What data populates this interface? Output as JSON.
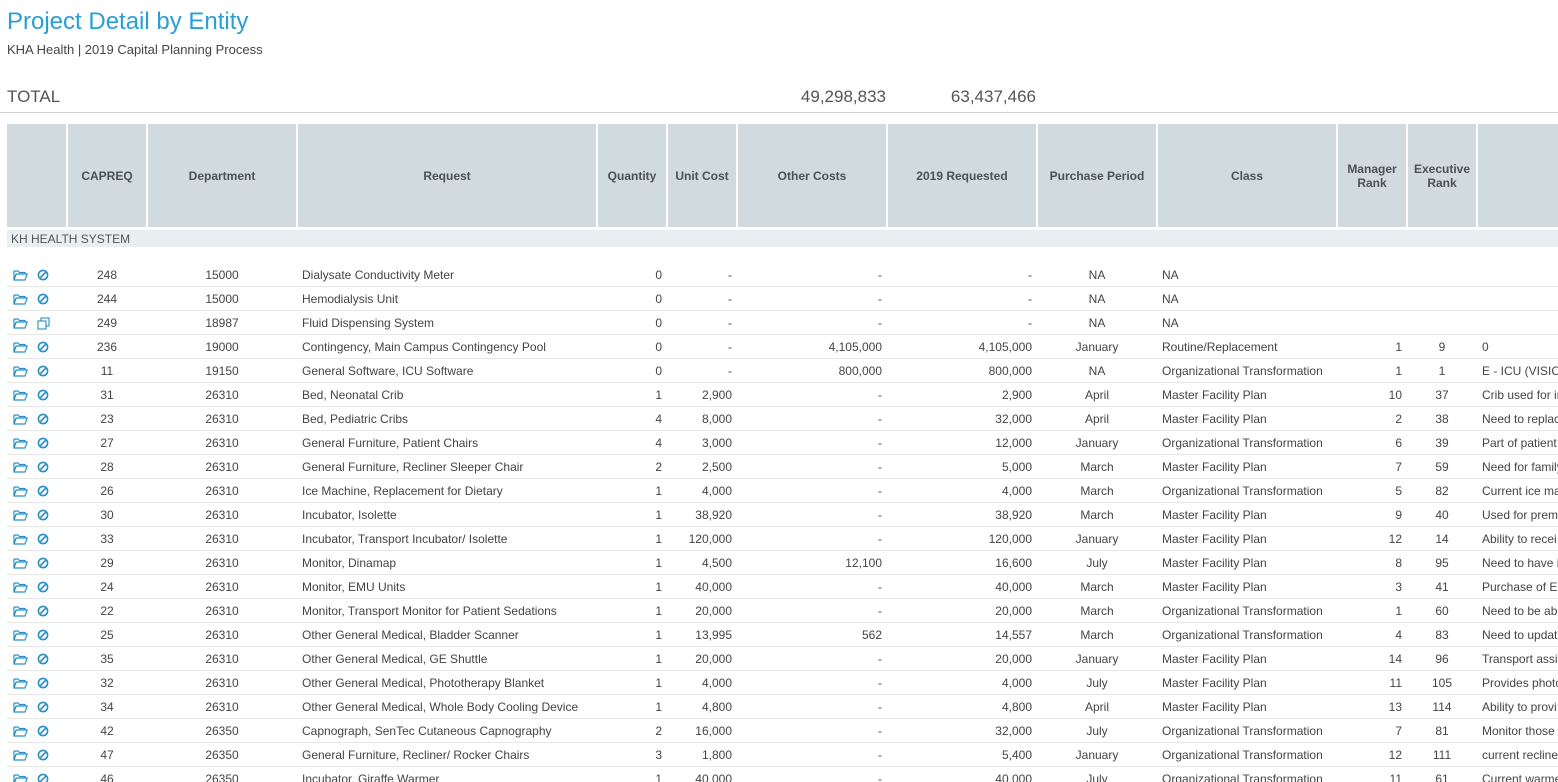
{
  "page": {
    "title": "Project Detail by Entity",
    "subtitle": "KHA Health | 2019 Capital Planning Process"
  },
  "totals": {
    "label": "TOTAL",
    "other_costs": "49,298,833",
    "requested": "63,437,466"
  },
  "table": {
    "columns": [
      "",
      "CAPREQ",
      "Department",
      "Request",
      "Quantity",
      "Unit Cost",
      "Other Costs",
      "2019 Requested",
      "Purchase Period",
      "Class",
      "Manager Rank",
      "Executive Rank",
      ""
    ],
    "group_label": "KH HEALTH SYSTEM",
    "rows": [
      {
        "icon": "cancel",
        "capreq": "248",
        "dept": "15000",
        "request": "Dialysate Conductivity Meter",
        "qty": "0",
        "unit": "-",
        "other": "-",
        "requested": "-",
        "period": "NA",
        "class": "NA",
        "mgr": "",
        "exec": "",
        "notes": ""
      },
      {
        "icon": "cancel",
        "capreq": "244",
        "dept": "15000",
        "request": "Hemodialysis Unit",
        "qty": "0",
        "unit": "-",
        "other": "-",
        "requested": "-",
        "period": "NA",
        "class": "NA",
        "mgr": "",
        "exec": "",
        "notes": ""
      },
      {
        "icon": "copy",
        "capreq": "249",
        "dept": "18987",
        "request": "Fluid Dispensing System",
        "qty": "0",
        "unit": "-",
        "other": "-",
        "requested": "-",
        "period": "NA",
        "class": "NA",
        "mgr": "",
        "exec": "",
        "notes": ""
      },
      {
        "icon": "cancel",
        "capreq": "236",
        "dept": "19000",
        "request": "Contingency, Main Campus Contingency Pool",
        "qty": "0",
        "unit": "-",
        "other": "4,105,000",
        "requested": "4,105,000",
        "period": "January",
        "class": "Routine/Replacement",
        "mgr": "1",
        "exec": "9",
        "notes": "0"
      },
      {
        "icon": "cancel",
        "capreq": "11",
        "dept": "19150",
        "request": "General Software, ICU Software",
        "qty": "0",
        "unit": "-",
        "other": "800,000",
        "requested": "800,000",
        "period": "NA",
        "class": "Organizational Transformation",
        "mgr": "1",
        "exec": "1",
        "notes": "E - ICU (VISICU"
      },
      {
        "icon": "cancel",
        "capreq": "31",
        "dept": "26310",
        "request": "Bed, Neonatal Crib",
        "qty": "1",
        "unit": "2,900",
        "other": "-",
        "requested": "2,900",
        "period": "April",
        "class": "Master Facility Plan",
        "mgr": "10",
        "exec": "37",
        "notes": "Crib used for in"
      },
      {
        "icon": "cancel",
        "capreq": "23",
        "dept": "26310",
        "request": "Bed, Pediatric Cribs",
        "qty": "4",
        "unit": "8,000",
        "other": "-",
        "requested": "32,000",
        "period": "April",
        "class": "Master Facility Plan",
        "mgr": "2",
        "exec": "38",
        "notes": "Need to replac"
      },
      {
        "icon": "cancel",
        "capreq": "27",
        "dept": "26310",
        "request": "General Furniture, Patient Chairs",
        "qty": "4",
        "unit": "3,000",
        "other": "-",
        "requested": "12,000",
        "period": "January",
        "class": "Organizational Transformation",
        "mgr": "6",
        "exec": "39",
        "notes": "Part of patient"
      },
      {
        "icon": "cancel",
        "capreq": "28",
        "dept": "26310",
        "request": "General Furniture, Recliner Sleeper Chair",
        "qty": "2",
        "unit": "2,500",
        "other": "-",
        "requested": "5,000",
        "period": "March",
        "class": "Master Facility Plan",
        "mgr": "7",
        "exec": "59",
        "notes": "Need for family"
      },
      {
        "icon": "cancel",
        "capreq": "26",
        "dept": "26310",
        "request": "Ice Machine, Replacement for Dietary",
        "qty": "1",
        "unit": "4,000",
        "other": "-",
        "requested": "4,000",
        "period": "March",
        "class": "Organizational Transformation",
        "mgr": "5",
        "exec": "82",
        "notes": "Current ice ma"
      },
      {
        "icon": "cancel",
        "capreq": "30",
        "dept": "26310",
        "request": "Incubator, Isolette",
        "qty": "1",
        "unit": "38,920",
        "other": "-",
        "requested": "38,920",
        "period": "March",
        "class": "Master Facility Plan",
        "mgr": "9",
        "exec": "40",
        "notes": "Used for prema"
      },
      {
        "icon": "cancel",
        "capreq": "33",
        "dept": "26310",
        "request": "Incubator, Transport Incubator/ Isolette",
        "qty": "1",
        "unit": "120,000",
        "other": "-",
        "requested": "120,000",
        "period": "January",
        "class": "Master Facility Plan",
        "mgr": "12",
        "exec": "14",
        "notes": "Ability to recei"
      },
      {
        "icon": "cancel",
        "capreq": "29",
        "dept": "26310",
        "request": "Monitor, Dinamap",
        "qty": "1",
        "unit": "4,500",
        "other": "12,100",
        "requested": "16,600",
        "period": "July",
        "class": "Master Facility Plan",
        "mgr": "8",
        "exec": "95",
        "notes": "Need to have i"
      },
      {
        "icon": "cancel",
        "capreq": "24",
        "dept": "26310",
        "request": "Monitor, EMU Units",
        "qty": "1",
        "unit": "40,000",
        "other": "-",
        "requested": "40,000",
        "period": "March",
        "class": "Master Facility Plan",
        "mgr": "3",
        "exec": "41",
        "notes": "Purchase of Ec"
      },
      {
        "icon": "cancel",
        "capreq": "22",
        "dept": "26310",
        "request": "Monitor, Transport Monitor for Patient Sedations",
        "qty": "1",
        "unit": "20,000",
        "other": "-",
        "requested": "20,000",
        "period": "March",
        "class": "Organizational Transformation",
        "mgr": "1",
        "exec": "60",
        "notes": "Need to be abl"
      },
      {
        "icon": "cancel",
        "capreq": "25",
        "dept": "26310",
        "request": "Other General Medical, Bladder Scanner",
        "qty": "1",
        "unit": "13,995",
        "other": "562",
        "requested": "14,557",
        "period": "March",
        "class": "Organizational Transformation",
        "mgr": "4",
        "exec": "83",
        "notes": "Need to updat"
      },
      {
        "icon": "cancel",
        "capreq": "35",
        "dept": "26310",
        "request": "Other General Medical, GE Shuttle",
        "qty": "1",
        "unit": "20,000",
        "other": "-",
        "requested": "20,000",
        "period": "January",
        "class": "Master Facility Plan",
        "mgr": "14",
        "exec": "96",
        "notes": "Transport assi"
      },
      {
        "icon": "cancel",
        "capreq": "32",
        "dept": "26310",
        "request": "Other General Medical, Phototherapy Blanket",
        "qty": "1",
        "unit": "4,000",
        "other": "-",
        "requested": "4,000",
        "period": "July",
        "class": "Master Facility Plan",
        "mgr": "11",
        "exec": "105",
        "notes": "Provides photo"
      },
      {
        "icon": "cancel",
        "capreq": "34",
        "dept": "26310",
        "request": "Other General Medical, Whole Body Cooling Device",
        "qty": "1",
        "unit": "4,800",
        "other": "-",
        "requested": "4,800",
        "period": "April",
        "class": "Master Facility Plan",
        "mgr": "13",
        "exec": "114",
        "notes": "Ability to provi"
      },
      {
        "icon": "cancel",
        "capreq": "42",
        "dept": "26350",
        "request": "Capnograph, SenTec Cutaneous Capnography",
        "qty": "2",
        "unit": "16,000",
        "other": "-",
        "requested": "32,000",
        "period": "July",
        "class": "Organizational Transformation",
        "mgr": "7",
        "exec": "81",
        "notes": "Monitor those"
      },
      {
        "icon": "cancel",
        "capreq": "47",
        "dept": "26350",
        "request": "General Furniture, Recliner/ Rocker Chairs",
        "qty": "3",
        "unit": "1,800",
        "other": "-",
        "requested": "5,400",
        "period": "January",
        "class": "Organizational Transformation",
        "mgr": "12",
        "exec": "111",
        "notes": "current recline"
      },
      {
        "icon": "cancel",
        "capreq": "46",
        "dept": "26350",
        "request": "Incubator, Giraffe Warmer",
        "qty": "1",
        "unit": "40,000",
        "other": "-",
        "requested": "40,000",
        "period": "July",
        "class": "Organizational Transformation",
        "mgr": "11",
        "exec": "61",
        "notes": "Current warme"
      }
    ]
  },
  "colors": {
    "title": "#2a9fd6",
    "icon": "#2a8fc4",
    "header_bg": "#d1dadf",
    "group_bg": "#e9eef0"
  },
  "icons": {
    "open": "folder-open-icon",
    "cancel": "cancel-icon",
    "copy": "copy-icon"
  }
}
